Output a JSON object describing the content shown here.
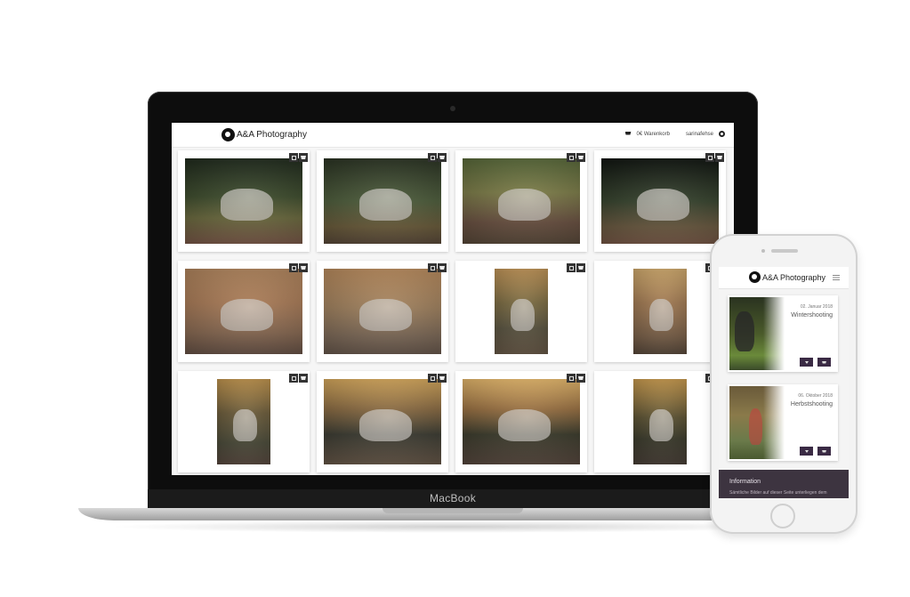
{
  "laptop": {
    "brand_label": "MacBook",
    "site": {
      "logo_text": "A&A Photography",
      "cart_label": "0€ Warenkorb",
      "user_label": "sarinafehse"
    },
    "gallery": [
      {
        "orientation": "landscape",
        "palette": "p1"
      },
      {
        "orientation": "landscape",
        "palette": "p2"
      },
      {
        "orientation": "landscape",
        "palette": "p3"
      },
      {
        "orientation": "landscape",
        "palette": "p4"
      },
      {
        "orientation": "landscape",
        "palette": "p5"
      },
      {
        "orientation": "landscape",
        "palette": "p6"
      },
      {
        "orientation": "portrait",
        "palette": "p7"
      },
      {
        "orientation": "portrait",
        "palette": "p8"
      },
      {
        "orientation": "portrait",
        "palette": "p9"
      },
      {
        "orientation": "landscape",
        "palette": "p10"
      },
      {
        "orientation": "landscape",
        "palette": "p11"
      },
      {
        "orientation": "portrait",
        "palette": "p12"
      }
    ]
  },
  "phone": {
    "logo_text": "A&A Photography",
    "galleries": [
      {
        "date": "02. Januar 2018",
        "title": "Wintershooting",
        "palette": "ph1"
      },
      {
        "date": "06. Oktober 2018",
        "title": "Herbstshooting",
        "palette": "ph2"
      }
    ],
    "info_title": "Information",
    "info_text": "Sämtliche Bilder auf dieser Seite unterliegen dem"
  },
  "icons": [
    "logo-mark-icon",
    "cart-icon",
    "gear-icon",
    "select-checkbox-icon",
    "add-to-cart-icon",
    "menu-icon",
    "download-icon"
  ]
}
